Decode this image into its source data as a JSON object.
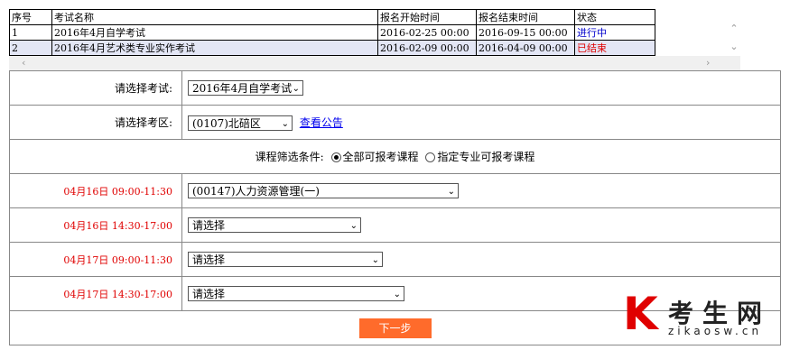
{
  "exam_list": {
    "headers": [
      "序号",
      "考试名称",
      "报名开始时间",
      "报名结束时间",
      "状态"
    ],
    "rows": [
      {
        "no": "1",
        "name": "2016年4月自学考试",
        "start": "2016-02-25 00:00",
        "end": "2016-09-15 00:00",
        "status": "进行中"
      },
      {
        "no": "2",
        "name": "2016年4月艺术类专业实作考试",
        "start": "2016-02-09 00:00",
        "end": "2016-04-09 00:00",
        "status": "已结束"
      }
    ]
  },
  "form": {
    "exam_label": "请选择考试:",
    "exam_value": "2016年4月自学考试",
    "area_label": "请选择考区:",
    "area_value": "(0107)北碚区",
    "notice_link": "查看公告",
    "filter_label": "课程筛选条件:",
    "filter_all": "全部可报考课程",
    "filter_major": "指定专业可报考课程",
    "sessions": [
      {
        "time": "04月16日 09:00-11:30",
        "value": "(00147)人力资源管理(一)"
      },
      {
        "time": "04月16日 14:30-17:00",
        "value": "请选择"
      },
      {
        "time": "04月17日 09:00-11:30",
        "value": "请选择"
      },
      {
        "time": "04月17日 14:30-17:00",
        "value": "请选择"
      }
    ],
    "next_label": "下一步"
  },
  "watermark": {
    "logo_letter": "K",
    "brand": "考生网",
    "domain": "zikaosw.cn"
  },
  "colors": {
    "accent": "#ff6b2b",
    "status_open": "#0000cc",
    "status_closed": "#e00000",
    "time_red": "#e00000"
  }
}
